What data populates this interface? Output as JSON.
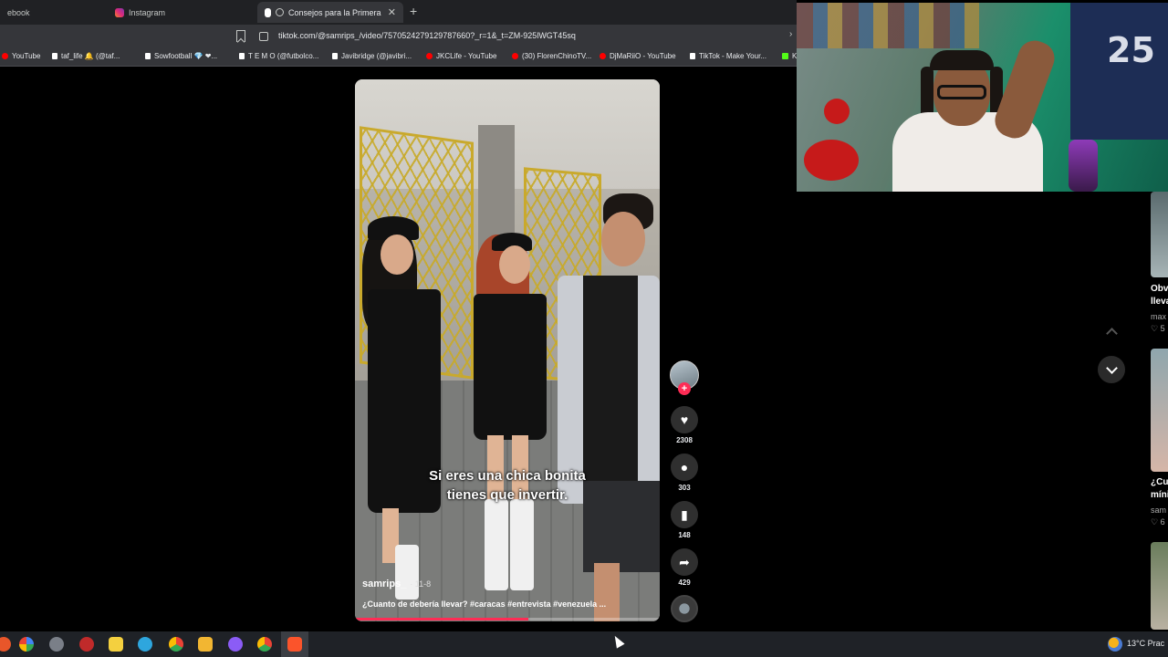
{
  "browser": {
    "tabs": [
      {
        "label": "ebook",
        "active": false
      },
      {
        "label": "Instagram",
        "active": false
      },
      {
        "label": "Consejos para la Primera Cita",
        "active": true
      }
    ],
    "close_glyph": "✕",
    "new_tab_glyph": "+",
    "url": "tiktok.com/@samrips_/video/7570524279129787660?_r=1&_t=ZM-925lWGT45sq",
    "bookmarks": [
      {
        "label": "YouTube",
        "icon": "youtube-icon"
      },
      {
        "label": "taf_life 🔔 (@taf...",
        "icon": "tiktok-icon"
      },
      {
        "label": "Sowfootball 💎 ❤...",
        "icon": "tiktok-icon"
      },
      {
        "label": "T E M O (@futbolco...",
        "icon": "tiktok-icon"
      },
      {
        "label": "Javibridge (@javibri...",
        "icon": "tiktok-icon"
      },
      {
        "label": "JKCLife - YouTube",
        "icon": "youtube-icon"
      },
      {
        "label": "(30) FlorenChinoTV...",
        "icon": "youtube-icon"
      },
      {
        "label": "DjMaRiiO - YouTube",
        "icon": "youtube-icon"
      },
      {
        "label": "TikTok - Make Your...",
        "icon": "tiktok-icon"
      },
      {
        "label": "K",
        "icon": "kick-icon"
      }
    ]
  },
  "video": {
    "caption_line1": "Si eres una chica bonita",
    "caption_line2": "tienes que invertir.",
    "author": "samrips_",
    "author_time": "· 11-8",
    "description": "¿Cuanto de debería llevar? #caracas #entrevista #venezuela ...",
    "progress": 0.57
  },
  "actions": {
    "follow_glyph": "+",
    "likes": "2308",
    "comments": "303",
    "saves": "148",
    "shares": "429"
  },
  "recommendations": [
    {
      "title": "Obv",
      "title2": "lleva",
      "meta": "max",
      "likes": "♡ 5"
    },
    {
      "title": "¿Cu",
      "title2": "míni",
      "meta": "sam",
      "likes": "♡ 6"
    }
  ],
  "webcam": {
    "jersey_number": "25"
  },
  "taskbar": {
    "temperature": "13°C Prac"
  },
  "colors": {
    "accent": "#fe2c55",
    "chrome_bg": "#202124",
    "toolbar_bg": "#35363a"
  }
}
